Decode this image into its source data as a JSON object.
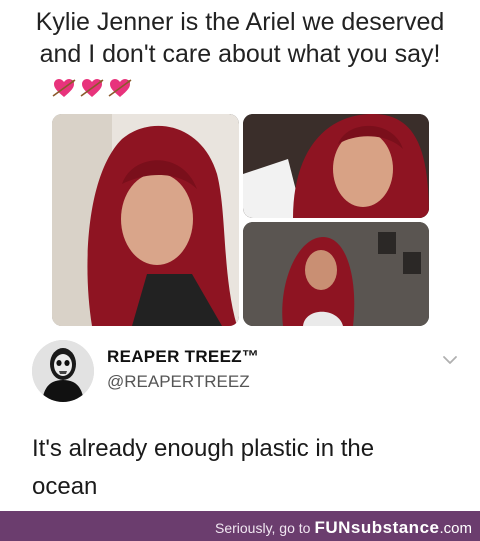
{
  "post": {
    "text_line1": "Kylie Jenner is the Ariel we deserved",
    "text_line2": "and I don't care about what you say!",
    "emoji": [
      "heart-with-arrow",
      "heart-with-arrow",
      "heart-with-arrow"
    ],
    "colors": {
      "heart": "#e8337c",
      "hair": "#8e1422"
    }
  },
  "reply": {
    "display_name": "REAPER TREEZ™",
    "handle": "@REAPERTREEZ",
    "text_line1": "It's already enough plastic in the",
    "text_line2": "ocean",
    "menu_icon": "chevron-down-icon"
  },
  "footer": {
    "prefix": "Seriously, go to",
    "brand": "FUNsubstance",
    "suffix": ".com",
    "color": "#6b3d6e"
  }
}
